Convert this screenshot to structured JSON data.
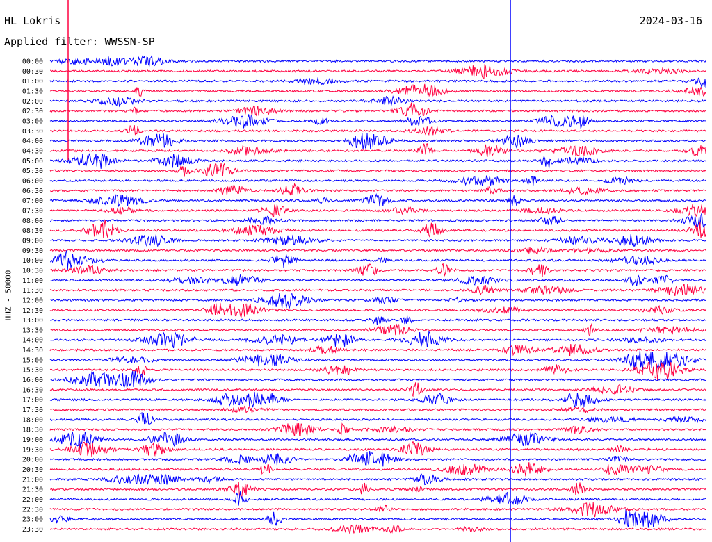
{
  "header": {
    "station": "HL Lokris",
    "date": "2024-03-16",
    "filter": "Applied filter: WWSSN-SP"
  },
  "colors": {
    "trace_a": "#0000ff",
    "trace_b": "#ff0040"
  },
  "chart_data": {
    "type": "line",
    "title": "HL Lokris",
    "ylabel": "HHZ - 50000",
    "date": "2024-03-16",
    "time_labels": [
      "00:00",
      "00:30",
      "01:00",
      "01:30",
      "02:00",
      "02:30",
      "03:00",
      "03:30",
      "04:00",
      "04:30",
      "05:00",
      "05:30",
      "06:00",
      "06:30",
      "07:00",
      "07:30",
      "08:00",
      "08:30",
      "09:00",
      "09:30",
      "10:00",
      "10:30",
      "11:00",
      "11:30",
      "12:00",
      "12:30",
      "13:00",
      "13:30",
      "14:00",
      "14:30",
      "15:00",
      "15:30",
      "16:00",
      "16:30",
      "17:00",
      "17:30",
      "18:00",
      "18:30",
      "19:00",
      "19:30",
      "20:00",
      "20:30",
      "21:00",
      "21:30",
      "22:00",
      "22:30",
      "23:00",
      "23:30"
    ],
    "minutes_per_row": 30,
    "series_colors": [
      "blue",
      "red"
    ],
    "grid": false
  }
}
